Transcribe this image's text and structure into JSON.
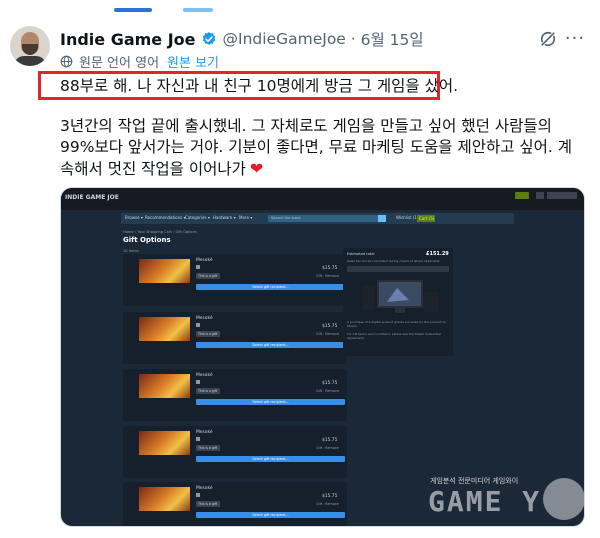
{
  "post": {
    "author_name": "Indie Game Joe",
    "handle": "@IndieGameJoe",
    "separator": "·",
    "date": "6월 15일",
    "translate_label": "원문 언어 영어",
    "translate_link": "원본 보기",
    "highlighted_text": "88부로 해. 나 자신과 내 친구 10명에게 방금 그 게임을 샀어.",
    "body_text": "3년간의 작업 끝에 출시했네. 그 자체로도 게임을 만들고 싶어 했던 사람들의 99%보다 앞서가는 거야. 기분이 좋다면, 무료 마케팅 도움을 제안하고 싶어. 계속해서 멋진 작업을 이어나가",
    "heart": "❤",
    "icons": [
      "verified-badge-icon",
      "grok-slash-icon",
      "more-icon",
      "translate-globe-icon",
      "heart-emoji-icon"
    ],
    "colors": {
      "link": "#1d9bf0",
      "muted": "#536471",
      "highlight_border": "#e0262d",
      "heart": "#e8192c"
    }
  },
  "embedded_screenshot": {
    "brand": "INDIE GAME JOE",
    "nav": [
      "Browse ▾",
      "Recommendations ▾",
      "Categories ▾",
      "Hardware ▾",
      "More ▾"
    ],
    "search_placeholder": "Search the store",
    "wishlist": "Wishlist (1)",
    "cart": "Cart (5)",
    "breadcrumb": "Home › Your Shopping Cart › Gift Options",
    "title": "Gift Options",
    "count": "10 items",
    "items": [
      {
        "game": "Mesoké",
        "price": "$15.75",
        "select": "This is a gift",
        "remove": "Gift · Remove",
        "gift_button": "Select gift recipient..."
      },
      {
        "game": "Mesoké",
        "price": "$15.75",
        "select": "This is a gift",
        "remove": "Gift · Remove",
        "gift_button": "Select gift recipient..."
      },
      {
        "game": "Mesoké",
        "price": "$15.75",
        "select": "This is a gift",
        "remove": "Gift · Remove",
        "gift_button": "Select gift recipient..."
      },
      {
        "game": "Mesoké",
        "price": "$15.75",
        "select": "This is a gift",
        "remove": "Gift · Remove",
        "gift_button": "Select gift recipient..."
      },
      {
        "game": "Mesoké",
        "price": "$15.75",
        "select": "This is a gift",
        "remove": "Gift · Remove",
        "gift_button": "Select gift recipient..."
      }
    ],
    "summary": {
      "estimated_total_label": "Estimated total",
      "estimated_total_value": "£151.29",
      "tax_note": "Sales tax will be calculated during checkout where applicable",
      "note1": "A purchase of a digital product grants a license for the product on Steam.",
      "note2": "For full terms and conditions, please see the Steam Subscriber Agreement."
    },
    "watermark_sub": "게임분석 전문미디어 게임와이",
    "watermark_main": "GAME Y"
  }
}
